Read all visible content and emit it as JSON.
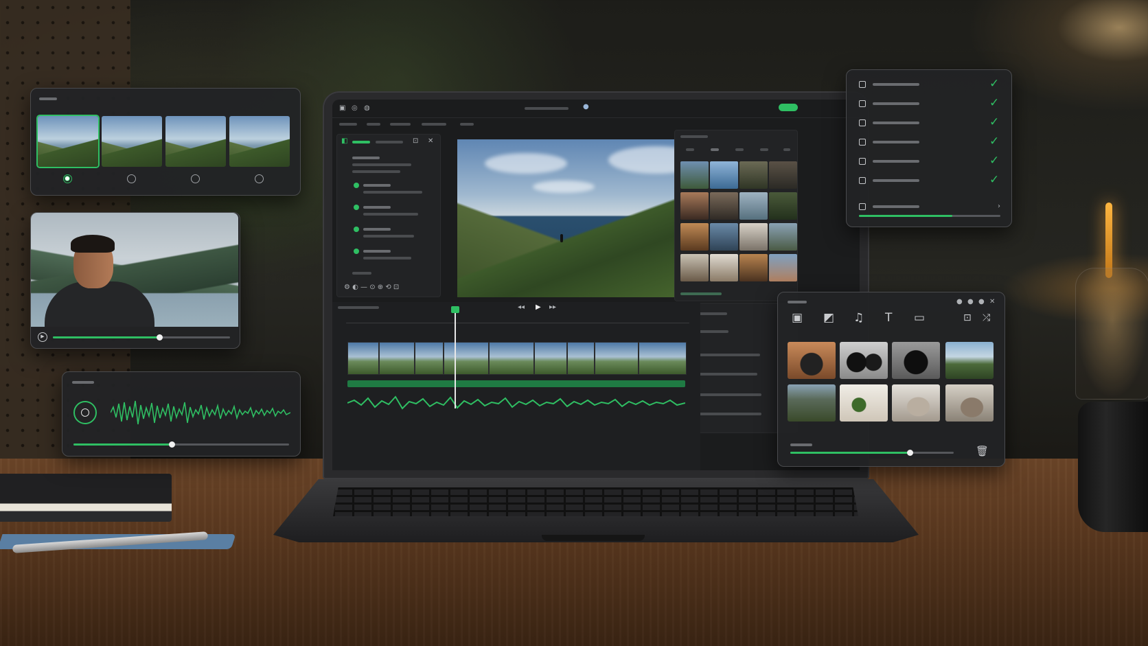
{
  "colors": {
    "accent": "#2fbf63",
    "panel_bg": "#222325",
    "panel_border": "#4a4b4e"
  },
  "editor": {
    "transport_icons": [
      "previous-frame-icon",
      "play-icon",
      "next-frame-icon"
    ],
    "preview_controls": [
      "skip-back-icon",
      "snapshot-icon",
      "skip-forward-icon",
      "fullscreen-icon"
    ]
  },
  "thumbnail_picker": {
    "selected_index": 0,
    "options": 4
  },
  "portrait_player": {
    "progress": 0.6
  },
  "audio_panel": {
    "volume": 0.55
  },
  "checklist": {
    "items_checked": 6,
    "progress": 0.66
  },
  "media_browser": {
    "tabs": [
      "image-icon",
      "photo-icon",
      "music-note-icon",
      "text-icon",
      "folder-icon"
    ],
    "progress": 0.73
  }
}
